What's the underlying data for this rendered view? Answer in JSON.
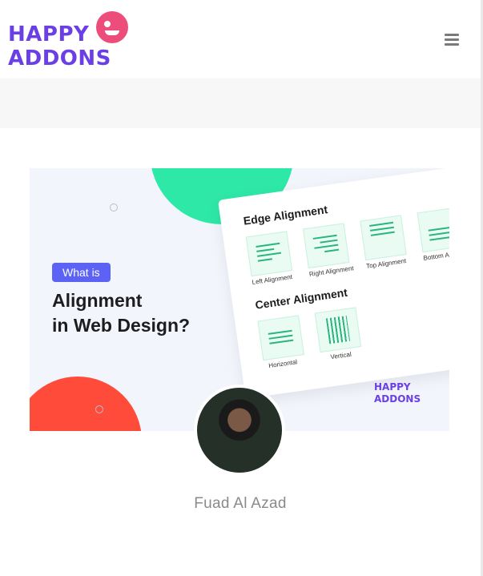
{
  "header": {
    "logo_line1": "HAPPY",
    "logo_line2": "ADDONS",
    "menu_icon": "hamburger-menu-icon"
  },
  "featured_image": {
    "tag": "What is",
    "headline_line1": "Alignment",
    "headline_line2": "in Web Design?",
    "section1_title": "Edge Alignment",
    "section1_items": [
      "Left Alignment",
      "Right Alignment",
      "Top Alignment",
      "Bottom Alignment"
    ],
    "section2_title": "Center Alignment",
    "section2_items": [
      "Horizontal",
      "Vertical"
    ],
    "mini_logo_line1": "HAPPY",
    "mini_logo_line2": "ADDONS",
    "colors": {
      "accent_green": "#2ee8a8",
      "accent_orange": "#ff4b3a",
      "tag_blue": "#5b62f4",
      "brand_purple": "#6b3fe6",
      "brand_pink": "#ec4d7b"
    }
  },
  "author": {
    "name": "Fuad Al Azad"
  }
}
